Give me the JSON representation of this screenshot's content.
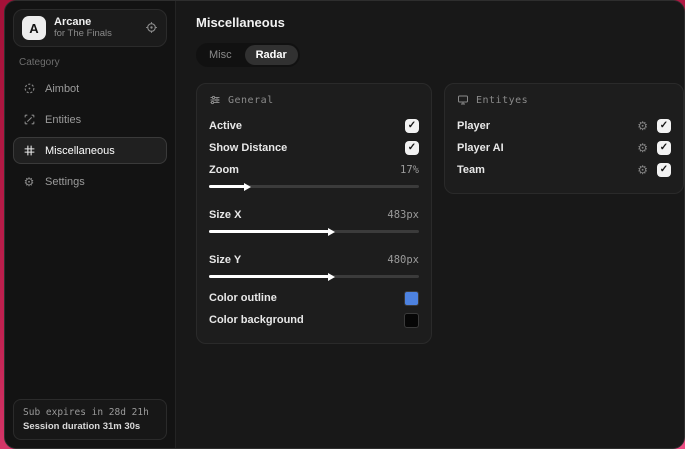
{
  "icons": {
    "check": "✓",
    "gear": "⚙",
    "logo_letter": "A"
  },
  "colors": {
    "accent_blue": "#4d82e0",
    "swatch_black": "#060606",
    "background_red": "#c02150"
  },
  "sidebar": {
    "app": {
      "name": "Arcane",
      "subtitle": "for The Finals"
    },
    "category_label": "Category",
    "items": [
      {
        "label": "Aimbot",
        "icon": "crosshair-icon",
        "active": false
      },
      {
        "label": "Entities",
        "icon": "entities-icon",
        "active": false
      },
      {
        "label": "Miscellaneous",
        "icon": "grid-icon",
        "active": true
      },
      {
        "label": "Settings",
        "icon": "gear-icon",
        "active": false
      }
    ],
    "footer": {
      "line1": "Sub expires in 28d 21h",
      "line2": "Session duration 31m 30s"
    }
  },
  "main": {
    "title": "Miscellaneous",
    "tabs": [
      {
        "label": "Misc",
        "active": false
      },
      {
        "label": "Radar",
        "active": true
      }
    ],
    "panels": {
      "general": {
        "title": "General",
        "icon": "sliders-icon",
        "rows": [
          {
            "label": "Active",
            "type": "checkbox",
            "checked": true
          },
          {
            "label": "Show Distance",
            "type": "checkbox",
            "checked": true
          },
          {
            "label": "Zoom",
            "type": "slider",
            "value": "17%",
            "percent": 17
          },
          {
            "label": "Size X",
            "type": "slider",
            "value": "483px",
            "percent": 57
          },
          {
            "label": "Size Y",
            "type": "slider",
            "value": "480px",
            "percent": 57
          },
          {
            "label": "Color outline",
            "type": "color",
            "color": "#4d82e0"
          },
          {
            "label": "Color background",
            "type": "color",
            "color": "#060606"
          }
        ]
      },
      "entities": {
        "title": "Entityes",
        "icon": "monitor-icon",
        "rows": [
          {
            "label": "Player",
            "checked": true
          },
          {
            "label": "Player AI",
            "checked": true
          },
          {
            "label": "Team",
            "checked": true
          }
        ]
      }
    }
  }
}
